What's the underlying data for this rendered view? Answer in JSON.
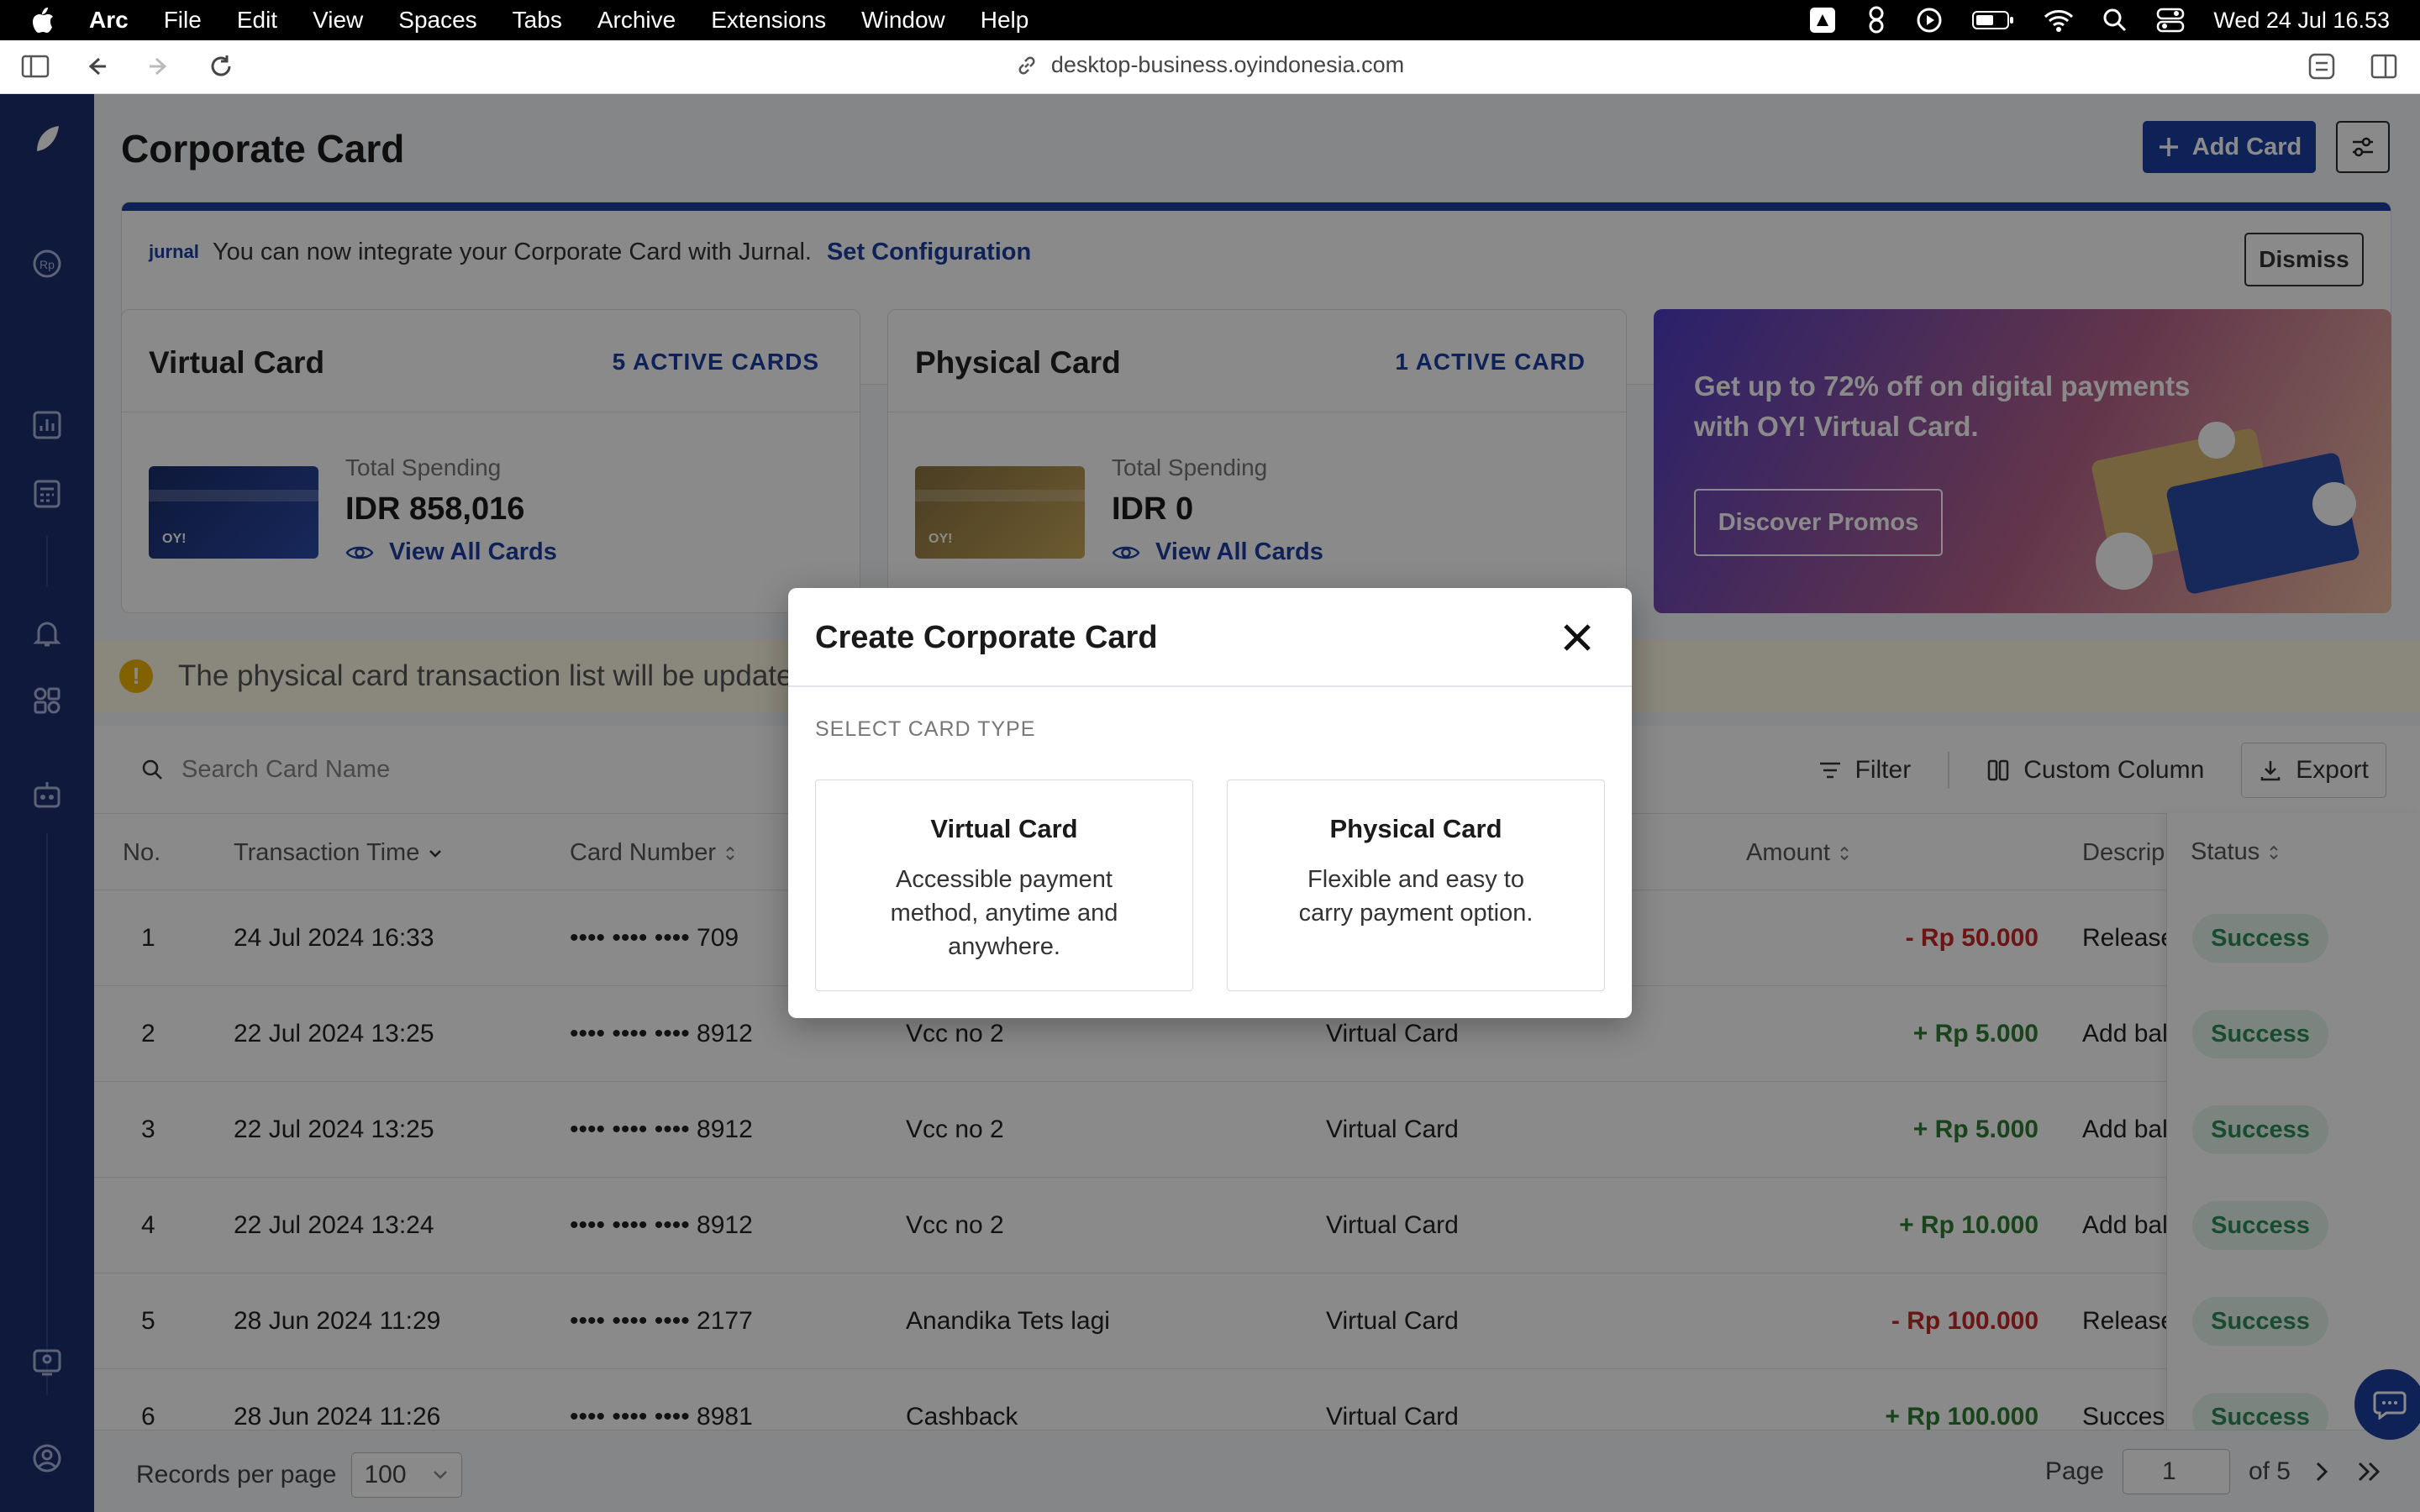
{
  "menubar": {
    "items": [
      "Arc",
      "File",
      "Edit",
      "View",
      "Spaces",
      "Tabs",
      "Archive",
      "Extensions",
      "Window",
      "Help"
    ],
    "clock": "Wed 24 Jul  16.53"
  },
  "browser": {
    "url": "desktop-business.oyindonesia.com"
  },
  "page": {
    "title": "Corporate Card",
    "add_card": "Add Card"
  },
  "banner": {
    "logo_text": "jurnal",
    "message": "You can now integrate your Corporate Card with Jurnal.",
    "link": "Set Configuration",
    "dismiss": "Dismiss"
  },
  "virtual_card": {
    "title": "Virtual Card",
    "count": "5 ACTIVE CARDS",
    "spending_label": "Total Spending",
    "spending_value": "IDR 858,016",
    "view_all": "View All Cards",
    "card_logo": "OY!"
  },
  "physical_card": {
    "title": "Physical Card",
    "count": "1 ACTIVE CARD",
    "spending_label": "Total Spending",
    "spending_value": "IDR 0",
    "view_all": "View All Cards",
    "card_logo": "OY!"
  },
  "promo": {
    "text": "Get up to 72% off on digital payments with OY! Virtual Card.",
    "button": "Discover Promos"
  },
  "warning": {
    "text": "The physical card transaction list will be updated"
  },
  "table": {
    "search_placeholder": "Search Card Name",
    "filter": "Filter",
    "custom_column": "Custom Column",
    "export": "Export",
    "headers": {
      "no": "No.",
      "time": "Transaction Time",
      "card_number": "Card Number",
      "amount": "Amount",
      "description": "Descrip",
      "status": "Status"
    },
    "rows": [
      {
        "no": "1",
        "time": "24 Jul 2024 16:33",
        "card": "•••• •••• •••• 709",
        "name": "",
        "type": "",
        "amount": "- Rp 50.000",
        "sign": "neg",
        "desc": "Release",
        "status": "Success"
      },
      {
        "no": "2",
        "time": "22 Jul 2024 13:25",
        "card": "•••• •••• •••• 8912",
        "name": "Vcc no 2",
        "type": "Virtual Card",
        "amount": "+ Rp 5.000",
        "sign": "pos",
        "desc": "Add bal",
        "status": "Success"
      },
      {
        "no": "3",
        "time": "22 Jul 2024 13:25",
        "card": "•••• •••• •••• 8912",
        "name": "Vcc no 2",
        "type": "Virtual Card",
        "amount": "+ Rp 5.000",
        "sign": "pos",
        "desc": "Add bal",
        "status": "Success"
      },
      {
        "no": "4",
        "time": "22 Jul 2024 13:24",
        "card": "•••• •••• •••• 8912",
        "name": "Vcc no 2",
        "type": "Virtual Card",
        "amount": "+ Rp 10.000",
        "sign": "pos",
        "desc": "Add bal",
        "status": "Success"
      },
      {
        "no": "5",
        "time": "28 Jun 2024 11:29",
        "card": "•••• •••• •••• 2177",
        "name": "Anandika Tets lagi",
        "type": "Virtual Card",
        "amount": "- Rp 100.000",
        "sign": "neg",
        "desc": "Release",
        "status": "Success"
      },
      {
        "no": "6",
        "time": "28 Jun 2024 11:26",
        "card": "•••• •••• •••• 8981",
        "name": "Cashback",
        "type": "Virtual Card",
        "amount": "+ Rp 100.000",
        "sign": "pos",
        "desc": "Succes",
        "status": "Success"
      }
    ]
  },
  "footer": {
    "records_label": "Records per page",
    "records_value": "100",
    "page_label": "Page",
    "page_value": "1",
    "of_label": "of 5"
  },
  "modal": {
    "title": "Create Corporate Card",
    "section_label": "SELECT CARD TYPE",
    "options": [
      {
        "title": "Virtual Card",
        "desc": "Accessible payment method, anytime and anywhere."
      },
      {
        "title": "Physical Card",
        "desc": "Flexible and easy to carry payment option."
      }
    ]
  },
  "colors": {
    "brand": "#1c3fa3",
    "sidebar": "#1c2f6e",
    "success": "#2e8b57",
    "negative": "#c62828",
    "positive": "#2e7d32"
  }
}
